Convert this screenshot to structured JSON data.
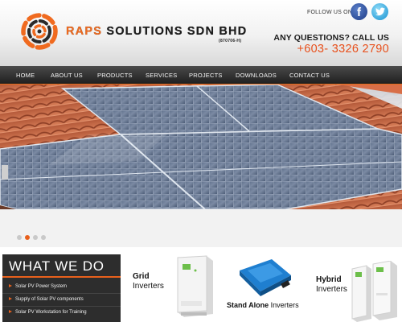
{
  "header": {
    "brand_name_accent": "RAPS",
    "brand_name_rest": " SOLUTIONS SDN BHD",
    "brand_reg": "(870706-H)",
    "follow_label": "FOLLOW US ON :",
    "facebook_glyph": "f",
    "any_questions": "ANY QUESTIONS? CALL US",
    "phone": "+603- 3326 2790",
    "accent_color": "#e8601c"
  },
  "nav": {
    "items": [
      "HOME",
      "ABOUT US",
      "PRODUCTS",
      "SERVICES",
      "PROJECTS",
      "DOWNLOADS",
      "CONTACT US"
    ]
  },
  "slider": {
    "slide_count": 4,
    "active_index": 1
  },
  "what_we_do": {
    "title": "WHAT WE DO",
    "items": [
      "Solar PV Power System",
      "Supply of Solar PV components",
      "Solar PV Workstation for Training"
    ]
  },
  "products": {
    "grid_bold": "Grid",
    "grid_rest": "Inverters",
    "standalone_bold": "Stand Alone",
    "standalone_rest": " Inverters",
    "hybrid_bold": "Hybrid",
    "hybrid_rest": "Inverters"
  },
  "icons": [
    "logo-swirl-icon",
    "facebook-icon",
    "twitter-icon",
    "bullet-arrow-icon"
  ]
}
